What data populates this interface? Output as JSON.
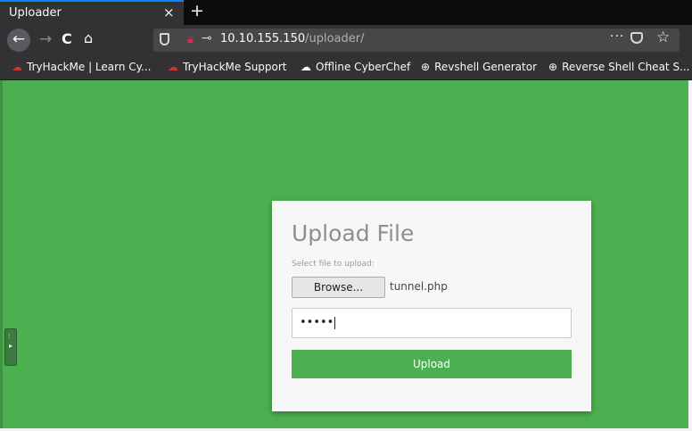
{
  "tab": {
    "title": "Uploader",
    "close": "×",
    "new_tab": "+"
  },
  "nav": {
    "back": "←",
    "forward": "→",
    "reload": "C",
    "home": "⌂"
  },
  "urlbar": {
    "host": "10.10.155.150",
    "path": "/uploader/",
    "more": "···",
    "star": "☆"
  },
  "bookmarks": [
    {
      "label": "TryHackMe | Learn Cy...",
      "icon": "tryhackme-icon"
    },
    {
      "label": "TryHackMe Support",
      "icon": "tryhackme-icon"
    },
    {
      "label": "Offline CyberChef",
      "icon": "chef-hat-icon"
    },
    {
      "label": "Revshell Generator",
      "icon": "globe-icon"
    },
    {
      "label": "Reverse Shell Cheat S...",
      "icon": "globe-icon"
    }
  ],
  "form": {
    "title": "Upload File",
    "label": "Select file to upload:",
    "browse_label": "Browse...",
    "file_name": "tunnel.php",
    "password_value": "•••••",
    "submit_label": "Upload"
  },
  "colors": {
    "page_bg": "#4caf50",
    "button_bg": "#4caf50",
    "tab_accent": "#0a84ff",
    "insecure_lock": "#e22850"
  }
}
